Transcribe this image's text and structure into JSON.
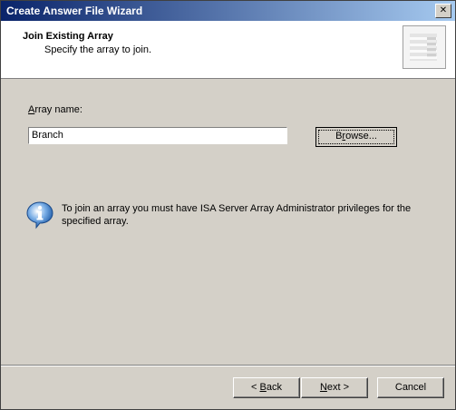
{
  "window": {
    "title": "Create Answer File Wizard",
    "close_glyph": "✕"
  },
  "header": {
    "title": "Join Existing Array",
    "subtitle": "Specify the array to join."
  },
  "form": {
    "label_prefix": "A",
    "label_rest": "rray name:",
    "array_value": "Branch",
    "browse_prefix": "B",
    "browse_mid": "r",
    "browse_rest": "owse..."
  },
  "info": {
    "icon": "info-icon",
    "text": "To join an array you must have ISA Server Array Administrator privileges for the specified array."
  },
  "footer": {
    "back_arrow": "< ",
    "back_u": "B",
    "back_rest": "ack",
    "next_u": "N",
    "next_rest": "ext",
    "next_arrow": " >",
    "cancel": "Cancel"
  },
  "colors": {
    "titlebar_start": "#0a246a",
    "titlebar_end": "#a6caf0",
    "face": "#d4d0c8"
  }
}
